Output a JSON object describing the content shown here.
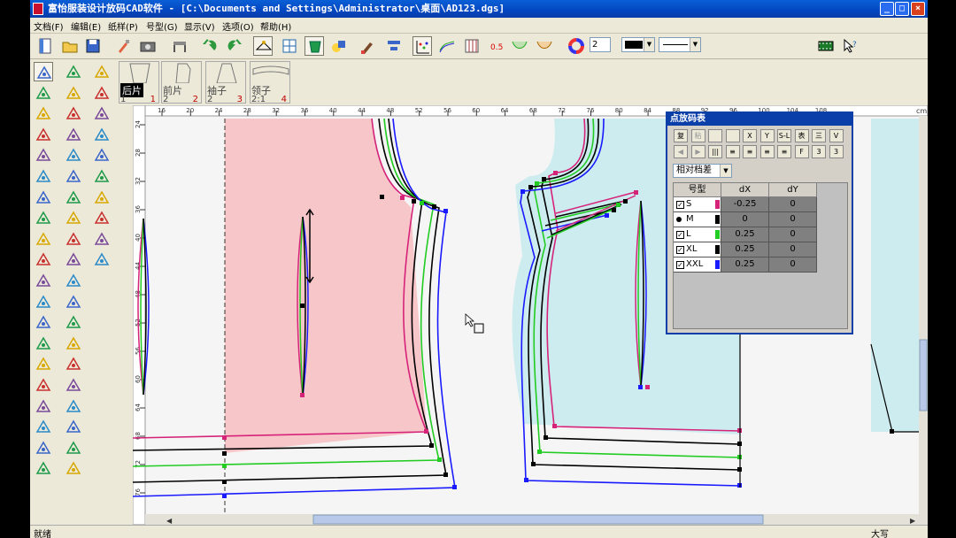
{
  "title": "富怡服装设计放码CAD软件 - [C:\\Documents and Settings\\Administrator\\桌面\\AD123.dgs]",
  "window_buttons": [
    "_",
    "□",
    "×"
  ],
  "menu": [
    "文档(F)",
    "编辑(E)",
    "纸样(P)",
    "号型(G)",
    "显示(V)",
    "选项(O)",
    "帮助(H)"
  ],
  "toolbar": {
    "line_width": "2"
  },
  "pieces": [
    {
      "name": "后片",
      "count": "1",
      "index": "1",
      "selected": true
    },
    {
      "name": "前片",
      "count": "2",
      "index": "2",
      "selected": false
    },
    {
      "name": "袖子",
      "count": "2",
      "index": "3",
      "selected": false
    },
    {
      "name": "领子",
      "count": "2:1",
      "index": "4",
      "selected": false
    }
  ],
  "ruler": {
    "unit": "cm",
    "top_ticks": [
      "16",
      "20",
      "24",
      "28",
      "32",
      "36",
      "40",
      "44",
      "48",
      "52",
      "56",
      "60",
      "64",
      "68",
      "72",
      "76",
      "80",
      "84",
      "88",
      "92",
      "96",
      "100",
      "104",
      "108"
    ],
    "left_ticks": [
      "24",
      "28",
      "32",
      "36",
      "40",
      "44",
      "48",
      "52",
      "56",
      "60",
      "64",
      "68",
      "72",
      "76",
      "80"
    ]
  },
  "panel": {
    "title": "点放码表",
    "mode": "相对档差",
    "columns": [
      "号型",
      "dX",
      "dY"
    ],
    "rows": [
      {
        "size": "S",
        "dx": "-0.25",
        "dy": "0",
        "color": "#d6237a",
        "check": "checkbox"
      },
      {
        "size": "M",
        "dx": "0",
        "dy": "0",
        "color": "#000000",
        "check": "radio"
      },
      {
        "size": "L",
        "dx": "0.25",
        "dy": "0",
        "color": "#22cc22",
        "check": "checkbox"
      },
      {
        "size": "XL",
        "dx": "0.25",
        "dy": "0",
        "color": "#000000",
        "check": "checkbox"
      },
      {
        "size": "XXL",
        "dx": "0.25",
        "dy": "0",
        "color": "#1a1aff",
        "check": "checkbox"
      }
    ],
    "buttons_row1": [
      "复",
      "粘",
      "",
      "",
      "X",
      "Y",
      "S-L",
      "表",
      "三",
      "V"
    ],
    "buttons_row2": [
      "◀",
      "▶",
      "|||",
      "≡",
      "≡",
      "≡",
      "≡",
      "F",
      "3",
      "3"
    ]
  },
  "status": {
    "left": "就绪",
    "caps": "大写"
  },
  "colors": {
    "S": "#d6237a",
    "M": "#000000",
    "L": "#22cc22",
    "XL": "#000000",
    "XXL": "#1a1aff",
    "back_fill": "#f7c6c9",
    "front_fill": "#cdecef"
  }
}
